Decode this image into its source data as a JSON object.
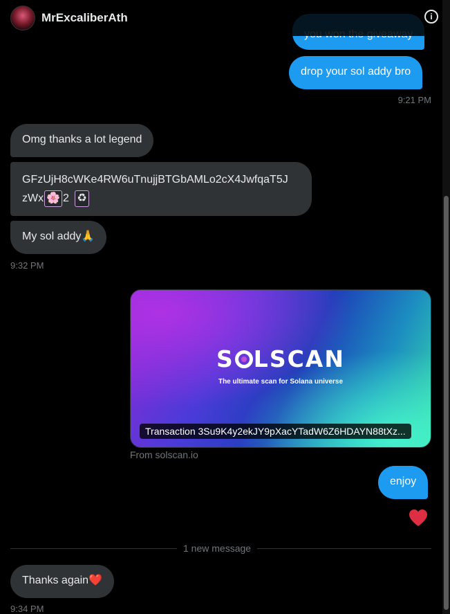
{
  "header": {
    "name": "MrExcaliberAth",
    "info_icon_glyph": "i"
  },
  "messages": {
    "sent_partial": "you won the giveaway",
    "sent_1": "drop your sol addy bro",
    "sent_1_time": "9:21 PM",
    "recv_1": "Omg thanks a lot legend",
    "recv_2_line1": "GFzUjH8cWKe4RW6uTnujjBTGbAMLo2cX4JwfqaT5J",
    "recv_2_line2": "zWx",
    "recv_2_chip1": "🌸",
    "recv_2_after_chip": "2",
    "recv_2_chip2": "♻",
    "recv_3": "My sol addy🙏",
    "recv_3_time": "9:32 PM",
    "card": {
      "logo_left": "S",
      "logo_right": "LSCAN",
      "tagline": "The ultimate scan for Solana universe",
      "caption": "Transaction 3Su9K4y2ekJY9pXacYTadW6Z6HDAYN88tXz...",
      "source": "From solscan.io"
    },
    "sent_2": "enjoy",
    "reaction": "heart",
    "divider": "1 new message",
    "recv_4": "Thanks again❤️",
    "recv_4_time": "9:34 PM"
  },
  "colors": {
    "sent_bubble": "#1d9bf0",
    "recv_bubble": "#2f3336",
    "reaction_heart": "#f91880"
  }
}
